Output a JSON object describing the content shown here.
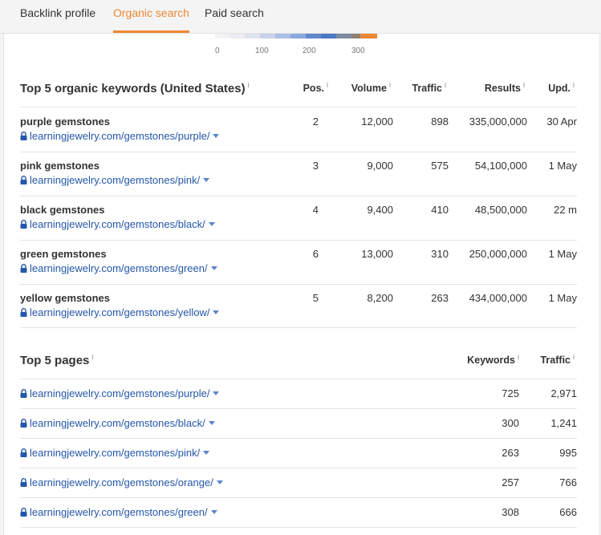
{
  "tabs": [
    "Backlink profile",
    "Organic search",
    "Paid search"
  ],
  "ramp": {
    "colors": [
      "#f3f3f6",
      "#ececf2",
      "#dfe3ee",
      "#c8d3ea",
      "#aabfe3",
      "#8aa8dc",
      "#5f88cc",
      "#4c78c4",
      "#7d8aa1",
      "#8e8174",
      "#ee8733"
    ],
    "labels": [
      "0",
      "100",
      "200",
      "300"
    ]
  },
  "keywords": {
    "title": "Top 5 organic keywords (United States)",
    "info": "i",
    "columns": [
      "Pos.",
      "Volume",
      "Traffic",
      "Results",
      "Upd."
    ],
    "rows": [
      {
        "keyword": "purple gemstones",
        "url": "learningjewelry.com/gemstones/purple/",
        "pos": "2",
        "volume": "12,000",
        "traffic": "898",
        "results": "335,000,000",
        "upd": "30 Apr"
      },
      {
        "keyword": "pink gemstones",
        "url": "learningjewelry.com/gemstones/pink/",
        "pos": "3",
        "volume": "9,000",
        "traffic": "575",
        "results": "54,100,000",
        "upd": "1 May"
      },
      {
        "keyword": "black gemstones",
        "url": "learningjewelry.com/gemstones/black/",
        "pos": "4",
        "volume": "9,400",
        "traffic": "410",
        "results": "48,500,000",
        "upd": "22 m"
      },
      {
        "keyword": "green gemstones",
        "url": "learningjewelry.com/gemstones/green/",
        "pos": "6",
        "volume": "13,000",
        "traffic": "310",
        "results": "250,000,000",
        "upd": "1 May"
      },
      {
        "keyword": "yellow gemstones",
        "url": "learningjewelry.com/gemstones/yellow/",
        "pos": "5",
        "volume": "8,200",
        "traffic": "263",
        "results": "434,000,000",
        "upd": "1 May"
      }
    ]
  },
  "pages": {
    "title": "Top 5 pages",
    "info": "i",
    "columns": [
      "Keywords",
      "Traffic"
    ],
    "rows": [
      {
        "url": "learningjewelry.com/gemstones/purple/",
        "keywords": "725",
        "traffic": "2,971"
      },
      {
        "url": "learningjewelry.com/gemstones/black/",
        "keywords": "300",
        "traffic": "1,241"
      },
      {
        "url": "learningjewelry.com/gemstones/pink/",
        "keywords": "263",
        "traffic": "995"
      },
      {
        "url": "learningjewelry.com/gemstones/orange/",
        "keywords": "257",
        "traffic": "766"
      },
      {
        "url": "learningjewelry.com/gemstones/green/",
        "keywords": "308",
        "traffic": "666"
      }
    ]
  }
}
